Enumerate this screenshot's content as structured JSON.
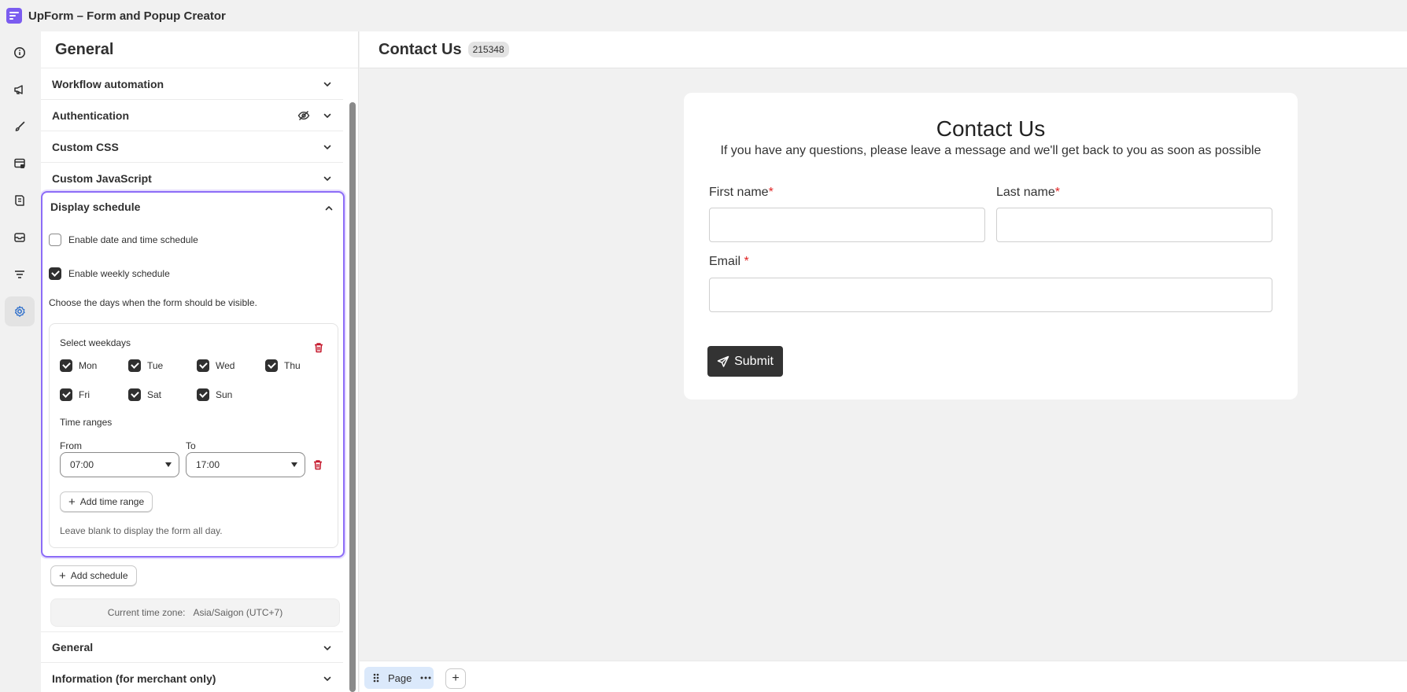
{
  "app": {
    "title": "UpForm – Form and Popup Creator"
  },
  "sidebar_rail": [
    {
      "name": "info-icon",
      "active": false
    },
    {
      "name": "megaphone-icon",
      "active": false
    },
    {
      "name": "brush-icon",
      "active": false
    },
    {
      "name": "layout-icon",
      "active": false
    },
    {
      "name": "receipt-icon",
      "active": false
    },
    {
      "name": "email-icon",
      "active": false
    },
    {
      "name": "filter-icon",
      "active": false
    },
    {
      "name": "gear-icon",
      "active": true
    }
  ],
  "panel": {
    "title": "General",
    "sections_top": [
      {
        "label": "Workflow automation"
      },
      {
        "label": "Authentication"
      },
      {
        "label": "Custom CSS"
      },
      {
        "label": "Custom JavaScript"
      }
    ],
    "display_schedule": {
      "label": "Display schedule",
      "date_time_label": "Enable date and time schedule",
      "date_time_checked": false,
      "weekly_label": "Enable weekly schedule",
      "weekly_checked": true,
      "hint": "Choose the days when the form should be visible.",
      "card": {
        "weekdays_label": "Select weekdays",
        "days": [
          {
            "label": "Mon",
            "checked": true
          },
          {
            "label": "Tue",
            "checked": true
          },
          {
            "label": "Wed",
            "checked": true
          },
          {
            "label": "Thu",
            "checked": true
          },
          {
            "label": "Fri",
            "checked": true
          },
          {
            "label": "Sat",
            "checked": true
          },
          {
            "label": "Sun",
            "checked": true
          }
        ],
        "time_ranges_label": "Time ranges",
        "from_label": "From",
        "to_label": "To",
        "from_value": "07:00",
        "to_value": "17:00",
        "add_time_range": "Add time range",
        "footer_hint": "Leave blank to display the form all day."
      },
      "add_schedule": "Add schedule",
      "timezone_label": "Current time zone:",
      "timezone_value": "Asia/Saigon (UTC+7)"
    },
    "sections_bottom": [
      {
        "label": "General"
      },
      {
        "label": "Information (for merchant only)"
      }
    ]
  },
  "canvas": {
    "title": "Contact Us",
    "id_badge": "215348",
    "form": {
      "title": "Contact Us",
      "subtitle": "If you have any questions, please leave a message and we'll get back to you as soon as possible",
      "first_name_label": "First name",
      "last_name_label": "Last name",
      "email_label": "Email",
      "required_mark": "*",
      "submit_label": "Submit"
    }
  },
  "bottom_bar": {
    "page_tab": "Page",
    "add_label": "+"
  },
  "colors": {
    "accent": "#8c6cf7",
    "danger": "#c5192d",
    "active_rail": "#2c6ecb"
  }
}
